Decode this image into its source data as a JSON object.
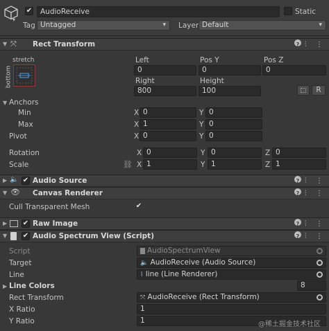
{
  "go": {
    "name": "AudioReceive",
    "static_label": "Static",
    "tag_label": "Tag",
    "tag_value": "Untagged",
    "layer_label": "Layer",
    "layer_value": "Default"
  },
  "rect": {
    "title": "Rect Transform",
    "anchor_preset_label": "stretch",
    "anchor_side_label": "bottom",
    "col_left": "Left",
    "col_posy": "Pos Y",
    "col_posz": "Pos Z",
    "left": "0",
    "posy": "0",
    "posz": "0",
    "col_right": "Right",
    "col_height": "Height",
    "right": "800",
    "height": "100",
    "raw_btn": "R",
    "anchors_label": "Anchors",
    "min_label": "Min",
    "max_label": "Max",
    "pivot_label": "Pivot",
    "min_x": "0",
    "min_y": "0",
    "max_x": "1",
    "max_y": "0",
    "pivot_x": "0",
    "pivot_y": "0",
    "rotation_label": "Rotation",
    "rot_x": "0",
    "rot_y": "0",
    "rot_z": "0",
    "scale_label": "Scale",
    "scale_x": "1",
    "scale_y": "1",
    "scale_z": "1",
    "axis_x": "X",
    "axis_y": "Y",
    "axis_z": "Z"
  },
  "audio_source": {
    "title": "Audio Source"
  },
  "canvas_renderer": {
    "title": "Canvas Renderer",
    "cull_label": "Cull Transparent Mesh"
  },
  "raw_image": {
    "title": "Raw Image"
  },
  "spectrum": {
    "title": "Audio Spectrum View (Script)",
    "script_label": "Script",
    "script_value": "AudioSpectrumView",
    "target_label": "Target",
    "target_value": "AudioReceive (Audio Source)",
    "line_label": "Line",
    "line_value": "line (Line Renderer)",
    "colors_label": "Line Colors",
    "colors_count": "8",
    "rt_label": "Rect Transform",
    "rt_value": "AudioReceive (Rect Transform)",
    "xratio_label": "X Ratio",
    "xratio_value": "1",
    "yratio_label": "Y Ratio",
    "yratio_value": "1"
  },
  "watermark": "@稀土掘金技术社区",
  "colors": {
    "bg": "#383838",
    "field": "#2a2a2a",
    "header": "#3e3e3e",
    "accent": "#4a90d9"
  }
}
